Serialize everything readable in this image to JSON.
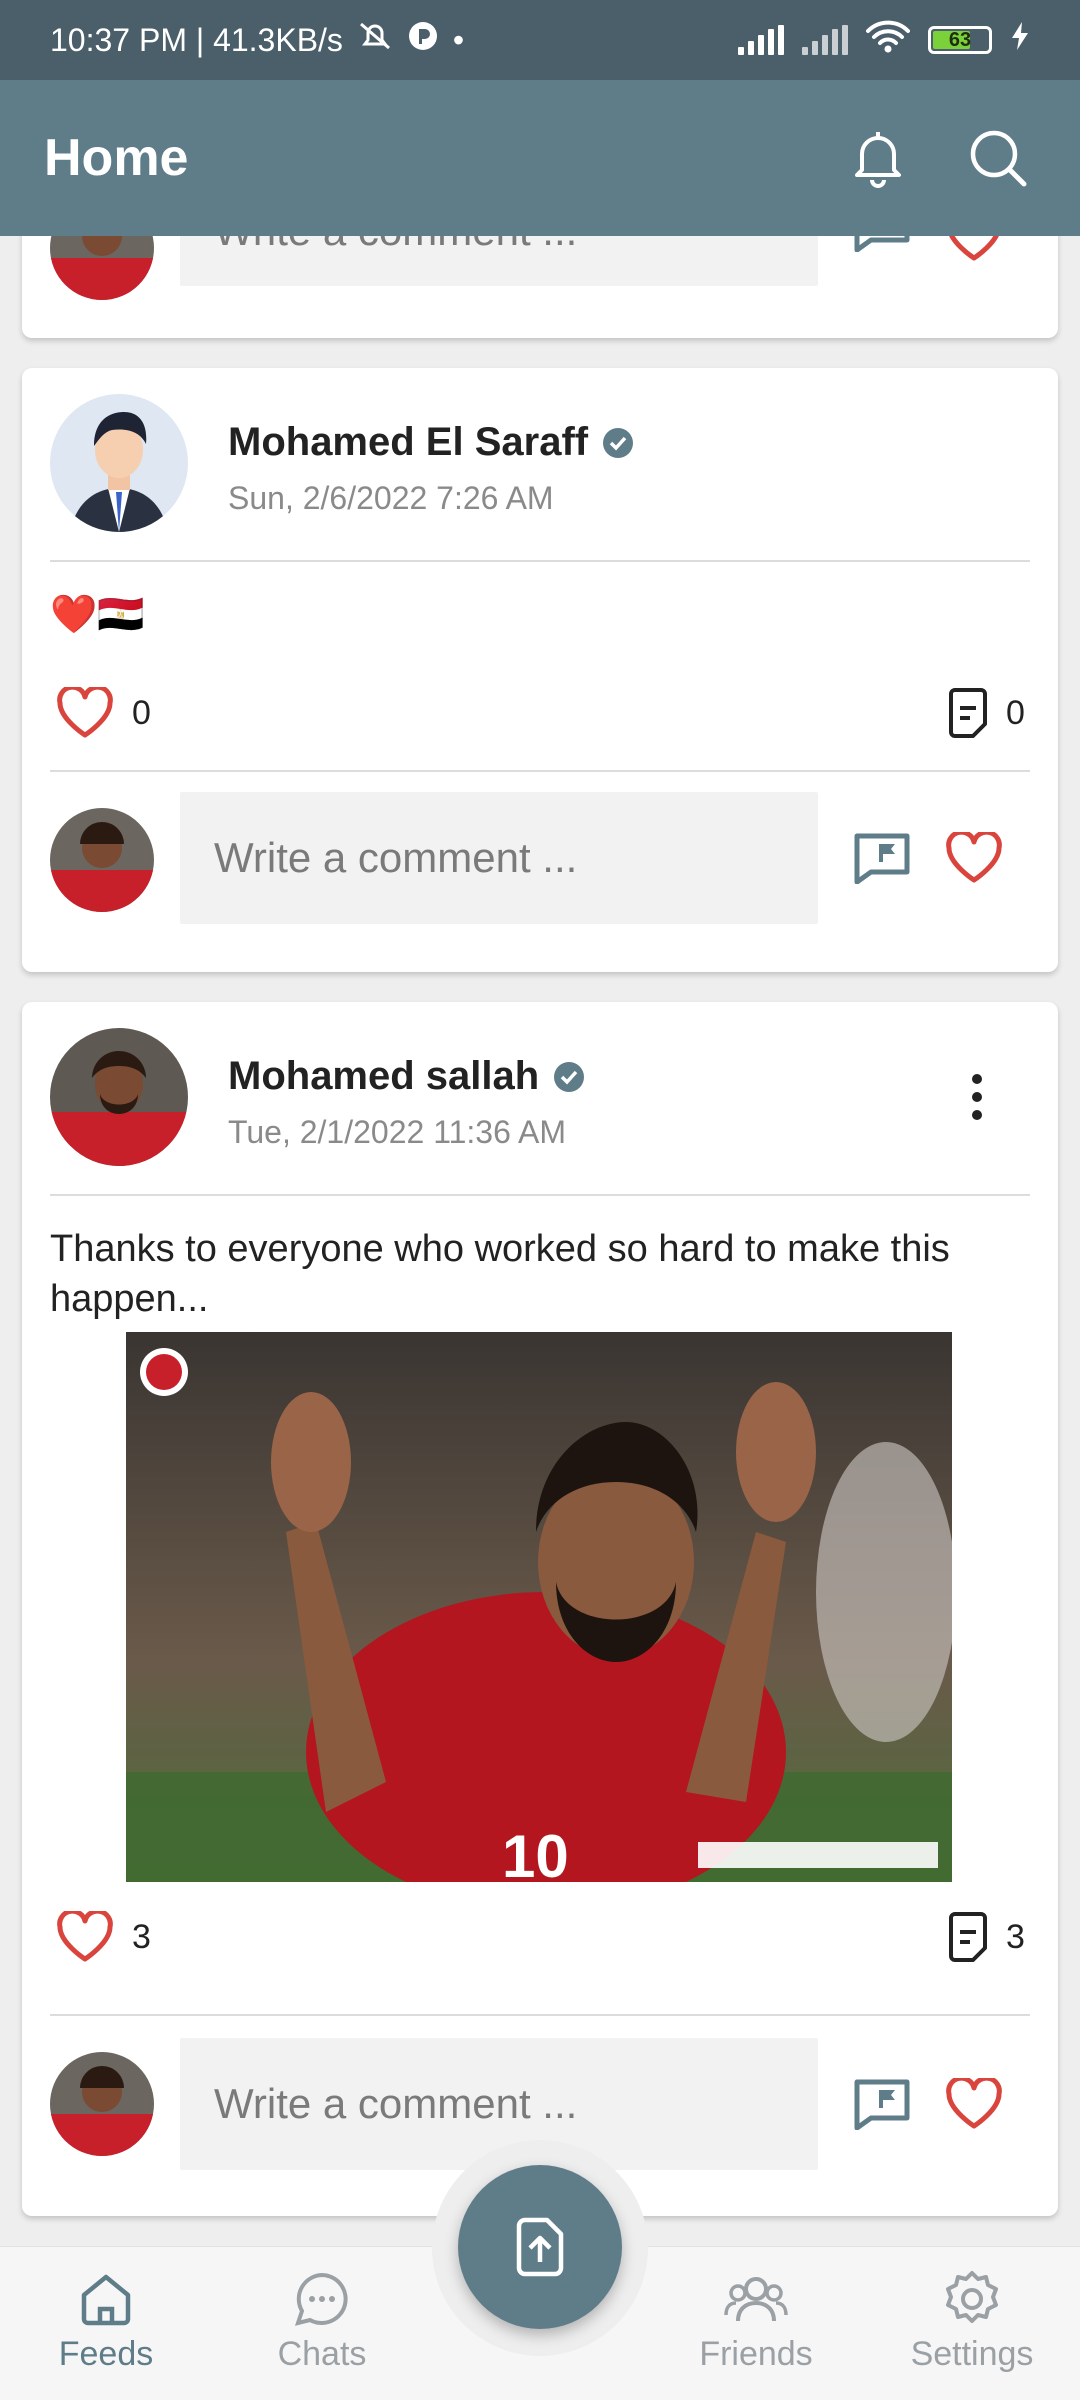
{
  "status_bar": {
    "time_speed": "10:37 PM | 41.3KB/s",
    "battery": "63",
    "battery_level": 0.63
  },
  "app_bar": {
    "title": "Home",
    "icons": [
      "bell-icon",
      "search-icon"
    ]
  },
  "partial_post": {
    "comment_placeholder": "Write a comment ..."
  },
  "posts": [
    {
      "author": "Mohamed El Saraff",
      "verified": true,
      "date": "Sun, 2/6/2022 7:26 AM",
      "text": "❤️🇪🇬",
      "likes": "0",
      "comments": "0",
      "comment_placeholder": "Write a comment ..."
    },
    {
      "author": "Mohamed sallah",
      "verified": true,
      "date": "Tue, 2/1/2022 11:36 AM",
      "text": "Thanks to everyone who worked so hard to make this happen...",
      "likes": "3",
      "comments": "3",
      "comment_placeholder": "Write a comment ..."
    }
  ],
  "bottom_nav": {
    "items": [
      {
        "label": "Feeds",
        "icon": "home-icon",
        "active": true
      },
      {
        "label": "Chats",
        "icon": "chat-icon",
        "active": false
      },
      {
        "label": "Friends",
        "icon": "friends-icon",
        "active": false
      },
      {
        "label": "Settings",
        "icon": "gear-icon",
        "active": false
      }
    ],
    "fab_icon": "upload-icon"
  },
  "colors": {
    "primary": "#5f7d89",
    "status_bar": "#4b5f6a",
    "heart": "#d9453d",
    "verified": "#5f7d89"
  }
}
